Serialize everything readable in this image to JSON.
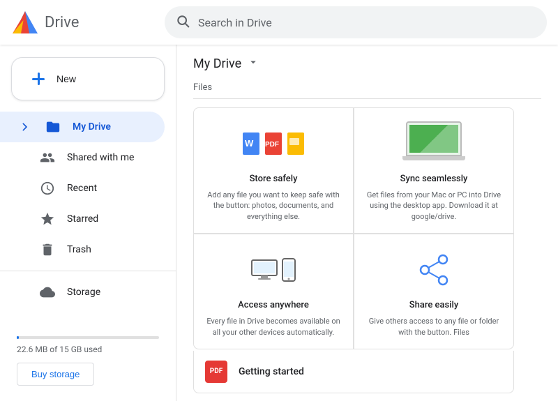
{
  "header": {
    "logo_text": "Drive",
    "search_placeholder": "Search in Drive"
  },
  "sidebar": {
    "new_button_label": "New",
    "nav_items": [
      {
        "id": "my-drive",
        "label": "My Drive",
        "icon": "folder",
        "active": true,
        "has_arrow": true
      },
      {
        "id": "shared",
        "label": "Shared with me",
        "icon": "people",
        "active": false
      },
      {
        "id": "recent",
        "label": "Recent",
        "icon": "clock",
        "active": false
      },
      {
        "id": "starred",
        "label": "Starred",
        "icon": "star",
        "active": false
      },
      {
        "id": "trash",
        "label": "Trash",
        "icon": "trash",
        "active": false
      }
    ],
    "storage_nav": {
      "id": "storage",
      "label": "Storage",
      "icon": "cloud"
    },
    "storage_used": "22.6 MB of 15 GB used",
    "storage_percent": 0.15,
    "buy_storage_label": "Buy storage"
  },
  "main": {
    "title": "My Drive",
    "section_label": "Files",
    "file_cards": [
      {
        "id": "store-safely",
        "title": "Store safely",
        "desc": "Add any file you want to keep safe with the button: photos, documents, and everything else."
      },
      {
        "id": "sync-seamlessly",
        "title": "Sync seamlessly",
        "desc": "Get files from your Mac or PC into Drive using the desktop app. Download it at google/drive."
      },
      {
        "id": "access-anywhere",
        "title": "Access anywhere",
        "desc": "Every file in Drive becomes available on all your other devices automatically."
      },
      {
        "id": "share-easily",
        "title": "Share easily",
        "desc": "Give others access to any file or folder with the button. Files"
      }
    ],
    "getting_started": {
      "label": "Getting started",
      "pdf_text": "PDF"
    }
  }
}
